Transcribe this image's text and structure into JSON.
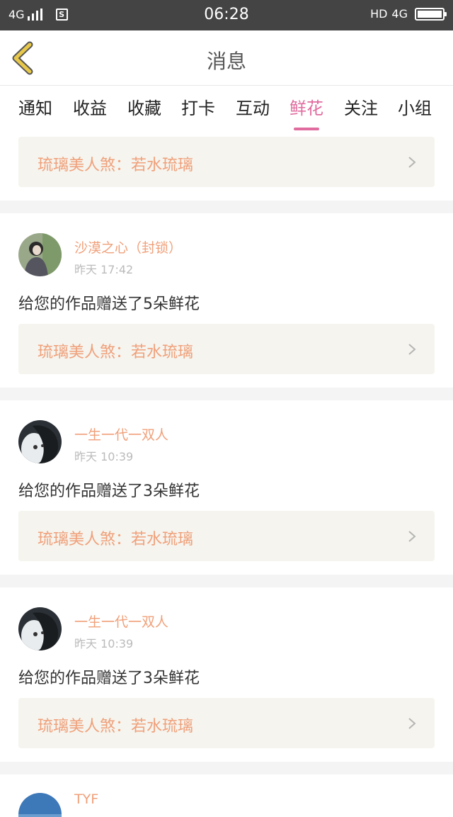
{
  "status_bar": {
    "network_left": "4G",
    "time": "06:28",
    "hd": "HD",
    "network_right": "4G",
    "sim_icon_label": "S"
  },
  "header": {
    "title": "消息"
  },
  "tabs": [
    {
      "label": "通知",
      "active": false
    },
    {
      "label": "收益",
      "active": false
    },
    {
      "label": "收藏",
      "active": false
    },
    {
      "label": "打卡",
      "active": false
    },
    {
      "label": "互动",
      "active": false
    },
    {
      "label": "鲜花",
      "active": true
    },
    {
      "label": "关注",
      "active": false
    },
    {
      "label": "小组",
      "active": false
    }
  ],
  "top_work_link": {
    "title": "琉璃美人煞：若水琉璃"
  },
  "messages": [
    {
      "user": "沙漠之心（封锁）",
      "time": "昨天 17:42",
      "text": "给您的作品赠送了5朵鲜花",
      "work": "琉璃美人煞：若水琉璃",
      "avatar": "avatar-woman-icon"
    },
    {
      "user": "一生一代一双人",
      "time": "昨天 10:39",
      "text": "给您的作品赠送了3朵鲜花",
      "work": "琉璃美人煞：若水琉璃",
      "avatar": "avatar-anime-icon"
    },
    {
      "user": "一生一代一双人",
      "time": "昨天 10:39",
      "text": "给您的作品赠送了3朵鲜花",
      "work": "琉璃美人煞：若水琉璃",
      "avatar": "avatar-anime-icon"
    },
    {
      "user": "TYF",
      "avatar": "avatar-sky-icon"
    }
  ],
  "colors": {
    "accent_pink": "#e06c9f",
    "name_orange": "#f0a07a",
    "status_bar": "#444444",
    "work_link_bg": "#f5f4ee",
    "back_chevron": "#e8c84a"
  }
}
